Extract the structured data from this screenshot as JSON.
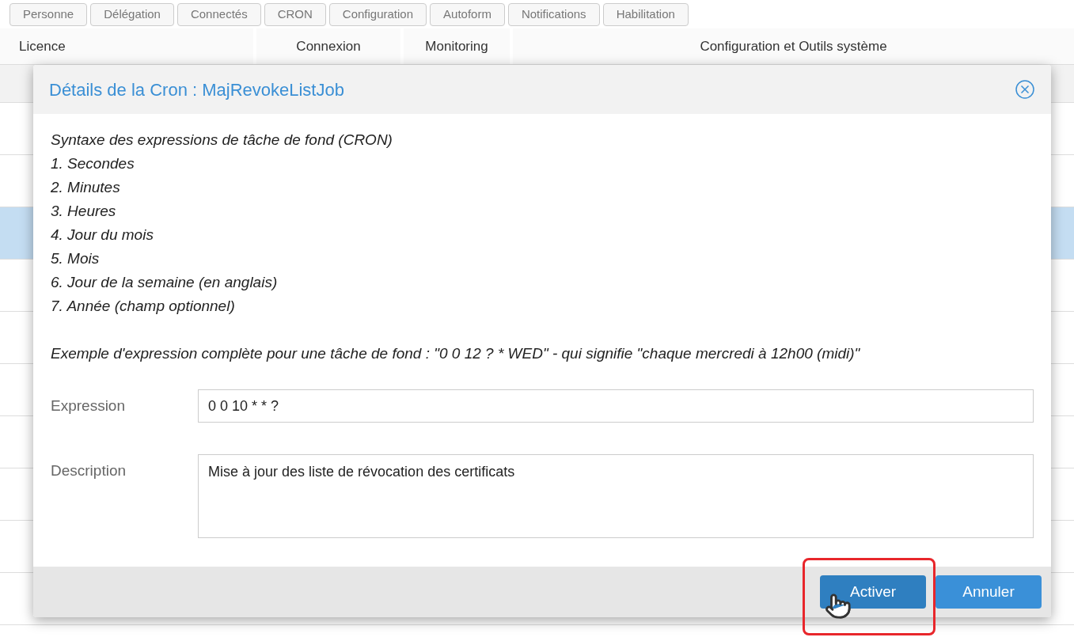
{
  "nav_buttons": [
    "Personne",
    "Délégation",
    "Connectés",
    "CRON",
    "Configuration",
    "Autoform",
    "Notifications",
    "Habilitation"
  ],
  "column_groups": [
    "Licence",
    "Connexion",
    "Monitoring",
    "Configuration et Outils système"
  ],
  "background_rows": [
    {
      "selected": false
    },
    {
      "selected": false
    },
    {
      "selected": true
    },
    {
      "selected": false
    },
    {
      "selected": false
    },
    {
      "selected": false
    },
    {
      "selected": false
    },
    {
      "selected": false
    },
    {
      "selected": false
    },
    {
      "selected": false
    }
  ],
  "dialog": {
    "title": "Détails de la Cron : MajRevokeListJob",
    "help_intro": "Syntaxe des expressions de tâche de fond (CRON)",
    "help_items": [
      "1. Secondes",
      "2. Minutes",
      "3. Heures",
      "4. Jour du mois",
      "5. Mois",
      "6. Jour de la semaine (en anglais)",
      "7. Année (champ optionnel)"
    ],
    "example": "Exemple d'expression complète pour une tâche de fond : \"0 0 12 ? * WED\" - qui signifie \"chaque mercredi à 12h00 (midi)\"",
    "fields": [
      {
        "label": "Expression",
        "value": "0 0 10 * * ?",
        "kind": "input"
      },
      {
        "label": "Description",
        "value": "Mise à jour des liste de révocation des certificats",
        "kind": "textarea"
      }
    ],
    "buttons": [
      {
        "label": "Activer",
        "highlighted": true
      },
      {
        "label": "Annuler",
        "highlighted": false
      }
    ]
  }
}
